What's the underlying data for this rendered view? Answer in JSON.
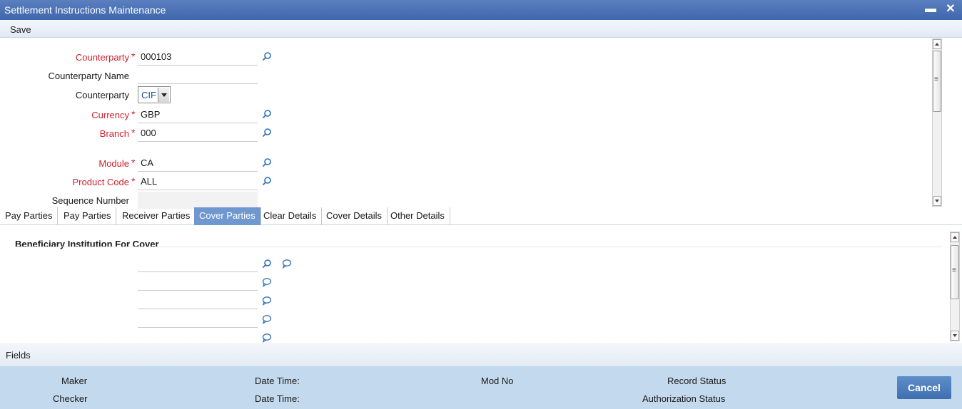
{
  "window": {
    "title": "Settlement Instructions Maintenance"
  },
  "menu": {
    "save_label": "Save"
  },
  "form": {
    "counterparty": {
      "label": "Counterparty",
      "value": "000103"
    },
    "counterparty_name": {
      "label": "Counterparty Name",
      "value": ""
    },
    "counterparty_type": {
      "label": "Counterparty",
      "value": "CIF"
    },
    "currency": {
      "label": "Currency",
      "value": "GBP"
    },
    "branch": {
      "label": "Branch",
      "value": "000"
    },
    "module": {
      "label": "Module",
      "value": "CA"
    },
    "product_code": {
      "label": "Product Code",
      "value": "ALL"
    },
    "sequence_number": {
      "label": "Sequence Number",
      "value": ""
    },
    "required_mark": "*"
  },
  "tabs": [
    {
      "label": "Pay Parties"
    },
    {
      "label": "Pay Parties"
    },
    {
      "label": "Receiver Parties"
    },
    {
      "label": "Cover Parties"
    },
    {
      "label": "Clear Details"
    },
    {
      "label": "Cover Details"
    },
    {
      "label": "Other Details"
    }
  ],
  "active_tab": "Cover Parties",
  "cover_section": {
    "title": "Beneficiary Institution For Cover",
    "rows": [
      "",
      "",
      "",
      ""
    ]
  },
  "fields_bar": {
    "label": "Fields"
  },
  "footer": {
    "maker": "Maker",
    "checker": "Checker",
    "date_time_1": "Date Time:",
    "date_time_2": "Date Time:",
    "mod_no": "Mod No",
    "record_status": "Record Status",
    "authorization_status": "Authorization Status",
    "cancel_label": "Cancel"
  },
  "colors": {
    "title_bar": "#4a70b2",
    "required": "#d0202e",
    "active_tab": "#6f97d0",
    "footer": "#c3d9ed",
    "cancel": "#4a7bbb"
  },
  "icons": [
    "search-icon",
    "comment-icon",
    "minimize-icon",
    "close-icon",
    "dropdown-arrow-icon"
  ]
}
